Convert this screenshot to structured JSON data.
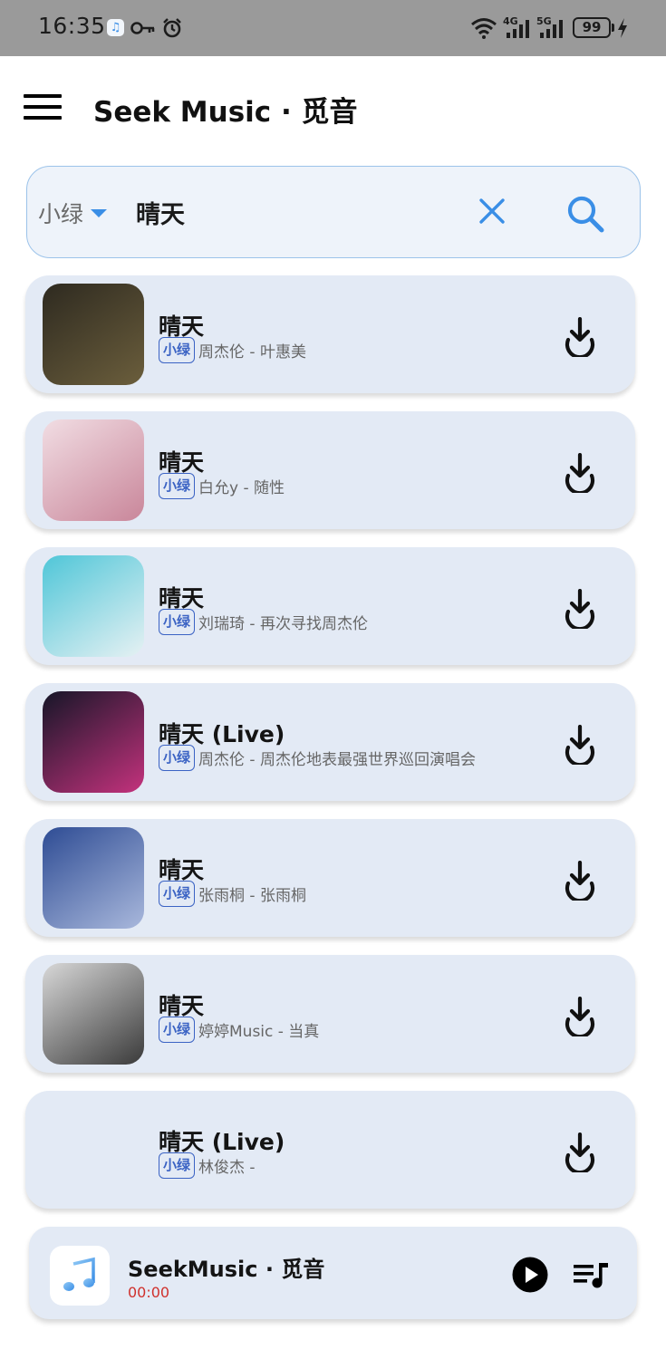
{
  "status_bar": {
    "time": "16:35",
    "battery": "99",
    "network_1": "4G",
    "network_2": "5G"
  },
  "app_bar": {
    "title": "Seek Music · 觅音"
  },
  "search": {
    "source": "小绿",
    "query": "晴天"
  },
  "songs": [
    {
      "title": "晴天",
      "tag": "小绿",
      "meta": "周杰伦 - 叶惠美",
      "cover_colors": [
        "#2e2a20",
        "#6b5e3c"
      ]
    },
    {
      "title": "晴天",
      "tag": "小绿",
      "meta": "白允y - 随性",
      "cover_colors": [
        "#f1dde3",
        "#c9869a"
      ]
    },
    {
      "title": "晴天",
      "tag": "小绿",
      "meta": "刘瑞琦 - 再次寻找周杰伦",
      "cover_colors": [
        "#4fc6d8",
        "#e6f1f3"
      ]
    },
    {
      "title": "晴天 (Live)",
      "tag": "小绿",
      "meta": "周杰伦 - 周杰伦地表最强世界巡回演唱会",
      "cover_colors": [
        "#161628",
        "#c4327d"
      ]
    },
    {
      "title": "晴天",
      "tag": "小绿",
      "meta": "张雨桐 - 张雨桐",
      "cover_colors": [
        "#2e4c94",
        "#a9b8dc"
      ]
    },
    {
      "title": "晴天",
      "tag": "小绿",
      "meta": "婷婷Music - 当真",
      "cover_colors": [
        "#d8d8d8",
        "#3a3a3a"
      ]
    },
    {
      "title": "晴天 (Live)",
      "tag": "小绿",
      "meta": "林俊杰 -",
      "cover_colors": []
    }
  ],
  "player": {
    "title": "SeekMusic · 觅音",
    "time": "00:00"
  },
  "colors": {
    "accent": "#3a8ee6",
    "card_bg": "#e3eaf5",
    "tag_blue": "#3b63c4",
    "time_red": "#d0312d"
  },
  "icons": {
    "menu": "hamburger-menu-icon",
    "caret": "caret-down-icon",
    "clear": "close-icon",
    "search": "search-icon",
    "download": "download-icon",
    "play": "play-icon",
    "queue": "playlist-icon",
    "music_note": "music-note-icon"
  }
}
